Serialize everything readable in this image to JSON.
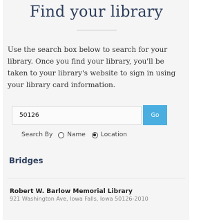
{
  "header": {
    "title": "Find your library"
  },
  "intro": {
    "text": "Use the search box below to search for your library. Once you find your library, you'll be taken to your library's website to sign in using your library card information."
  },
  "search": {
    "value": "50126",
    "go_label": "Go",
    "search_by_label": "Search By",
    "options": [
      "Name",
      "Location"
    ],
    "selected": "Location"
  },
  "results": {
    "city": "Bridges",
    "libraries": [
      {
        "name": "Robert W. Barlow Memorial Library",
        "address": "921 Washington Ave, Iowa Falls, Iowa 50126-2010"
      }
    ]
  },
  "colors": {
    "accent": "#4aaee0",
    "heading": "#2b3c5a"
  }
}
